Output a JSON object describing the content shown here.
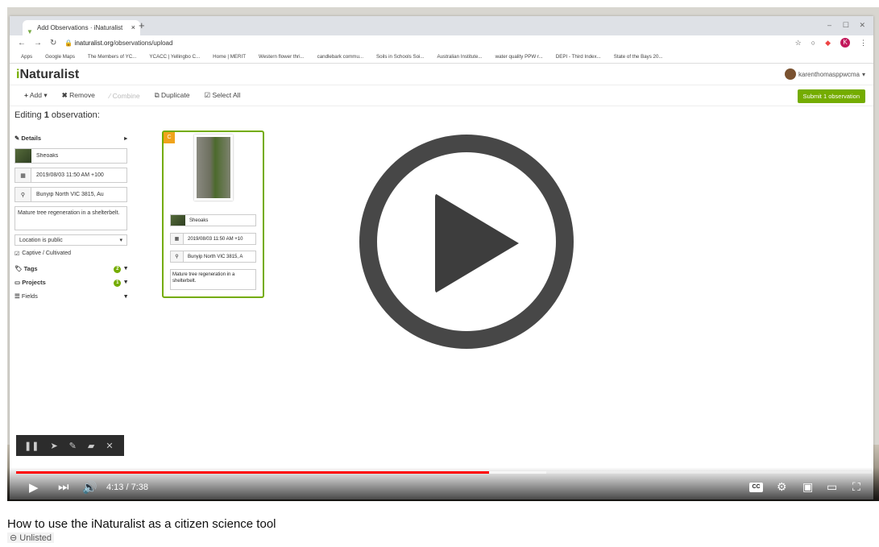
{
  "browser": {
    "tab_title": "Add Observations · iNaturalist",
    "url_host": "inaturalist.org",
    "url_path": "/observations/upload",
    "profile_initial": "K",
    "bookmarks": [
      "Apps",
      "Google Maps",
      "The Members of YC...",
      "YCACC | Yellingbo C...",
      "Home | MERIT",
      "Western flower thri...",
      "candlebark commu...",
      "Soils in Schools Soi...",
      "Australian Institute...",
      "water quality PPW r...",
      "DEPI - Third Index...",
      "State of the Bays 20..."
    ]
  },
  "inat": {
    "logo_i": "i",
    "logo_rest": "Naturalist",
    "username": "karenthomasppwcma",
    "toolbar": {
      "add": "Add",
      "remove": "Remove",
      "combine": "Combine",
      "duplicate": "Duplicate",
      "select_all": "Select All",
      "submit": "Submit 1 observation"
    },
    "editing_prefix": "Editing ",
    "editing_count": "1",
    "editing_suffix": " observation:",
    "details_label": "Details",
    "species": "Sheoaks",
    "date": "2019/08/03 11:50 AM +100",
    "location": "Bunyip North VIC 3815, Au",
    "notes": "Mature tree regeneration in a shelterbelt.",
    "geoprivacy": "Location is public",
    "captive": "Captive / Cultivated",
    "tags_label": "Tags",
    "tags_count": "2",
    "projects_label": "Projects",
    "projects_count": "1",
    "fields_label": "Fields",
    "card": {
      "corner": "C",
      "species": "Sheoaks",
      "date": "2019/08/03 11:50 AM +10",
      "location": "Bunyip North VIC 3815, A",
      "notes": "Mature tree regeneration in a shelterbelt."
    }
  },
  "player": {
    "time_current": "4:13",
    "time_total": "7:38",
    "progress_fraction": 0.553,
    "buffered_fraction": 0.62,
    "cc_label": "CC",
    "accent_color": "#ff0000"
  },
  "video": {
    "title": "How to use the iNaturalist as a citizen science tool",
    "visibility": "Unlisted"
  }
}
